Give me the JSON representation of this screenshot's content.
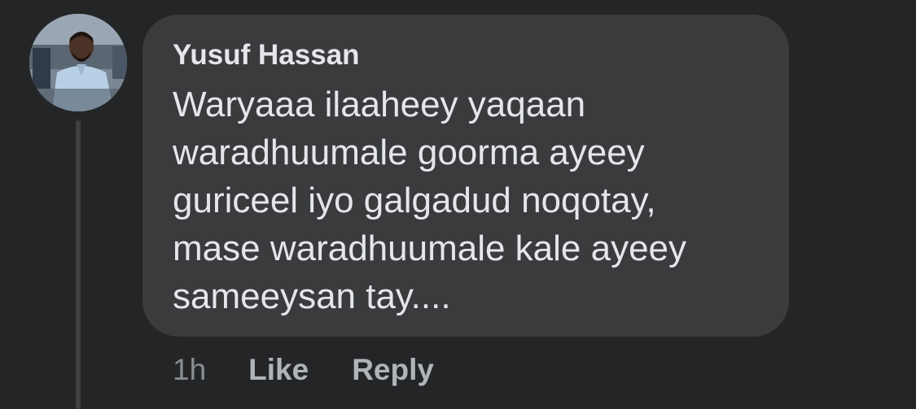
{
  "comment": {
    "author": "Yusuf Hassan",
    "text_lines": [
      "Waryaaa ilaaheey yaqaan",
      "waradhuumale goorma ayeey",
      "guriceel iyo galgadud noqotay,",
      "mase waradhuumale kale ayeey",
      "sameeysan tay...."
    ],
    "timestamp": "1h",
    "actions": {
      "like_label": "Like",
      "reply_label": "Reply"
    }
  },
  "colors": {
    "background": "#242526",
    "bubble": "#3a3b3c",
    "primary_text": "#e4e6eb",
    "secondary_text": "#b0b3b8",
    "thread_line": "#3e4042"
  }
}
